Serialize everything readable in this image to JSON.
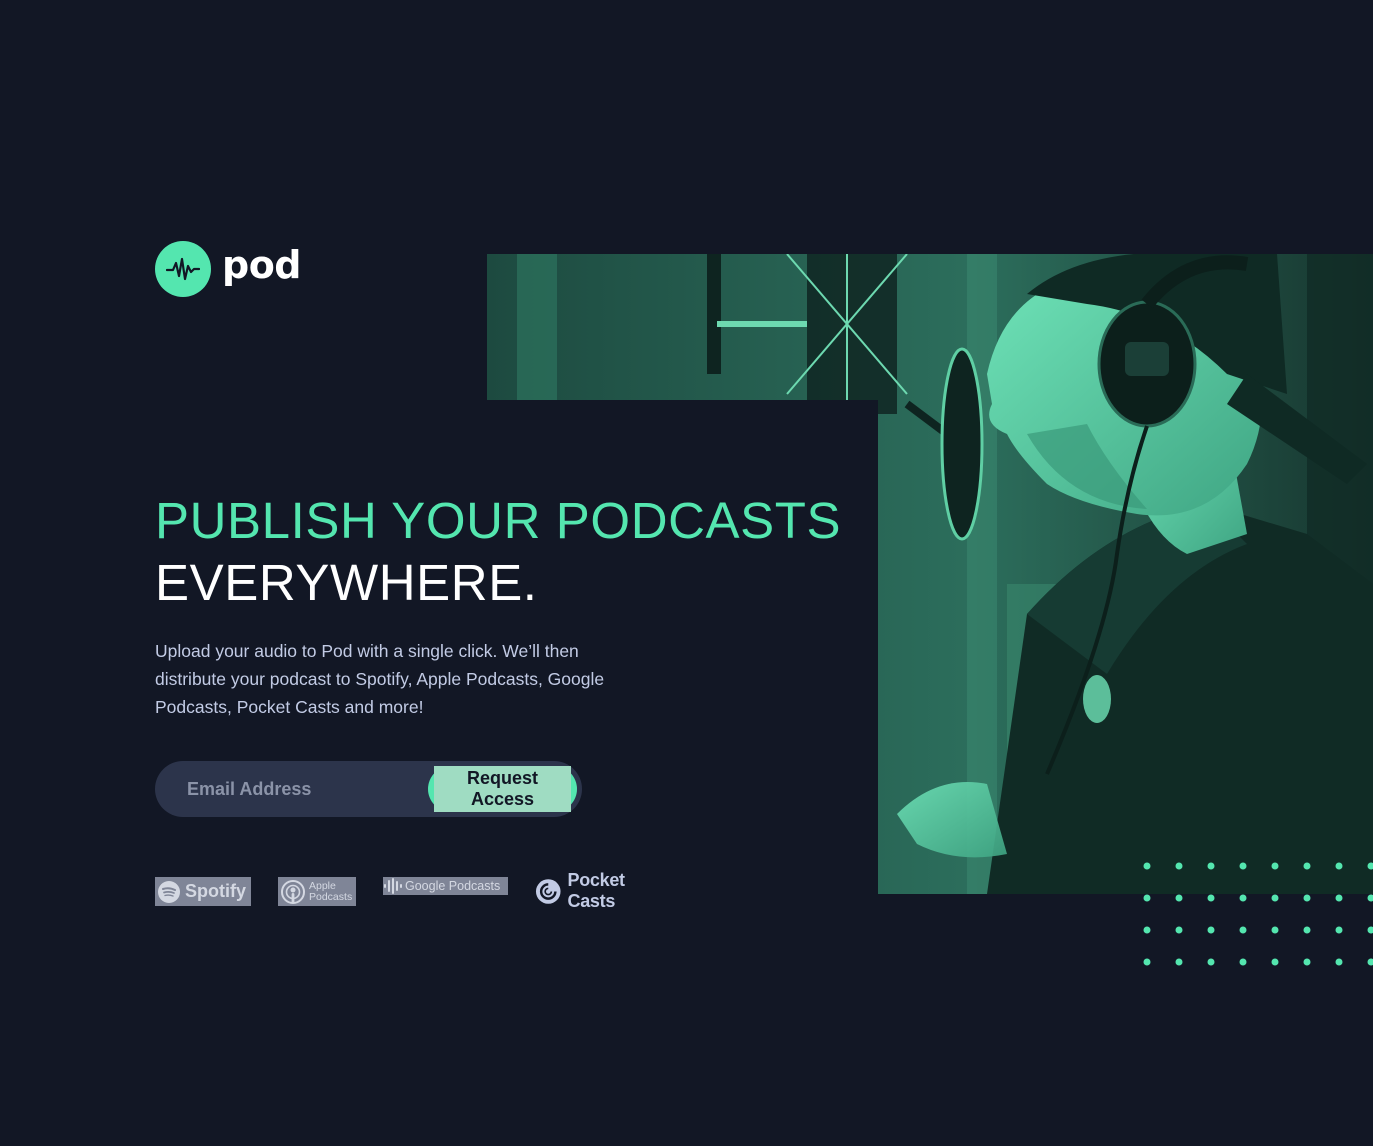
{
  "brand": {
    "name": "pod",
    "accent_color": "#54e6af",
    "background_color": "#121725"
  },
  "hero": {
    "headline_accent": "PUBLISH YOUR PODCASTS",
    "headline_plain": "EVERYWHERE.",
    "description": "Upload your audio to Pod with a single click. We’ll then distribute your podcast to Spotify, Apple Podcasts, Google Podcasts, Pocket Casts and more!"
  },
  "form": {
    "email_placeholder": "Email Address",
    "submit_label": "Request Access"
  },
  "platforms": {
    "spotify": "Spotify",
    "apple_line1": "Apple",
    "apple_line2": "Podcasts",
    "google": "Google Podcasts",
    "pocket": "Pocket Casts"
  }
}
